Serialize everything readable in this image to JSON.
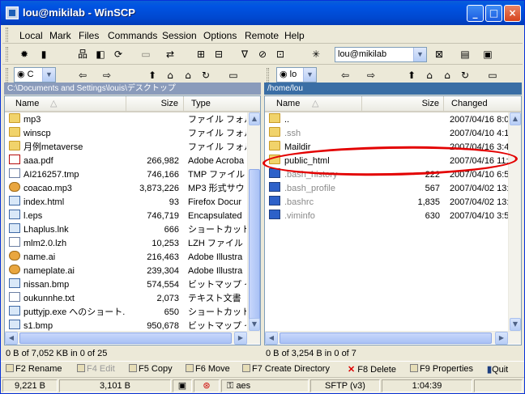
{
  "app": {
    "title": "lou@mikilab - WinSCP"
  },
  "menu": [
    "Local",
    "Mark",
    "Files",
    "Commands",
    "Session",
    "Options",
    "Remote",
    "Help"
  ],
  "toolbar": {
    "session": "lou@mikilab",
    "drive_left": "C",
    "drive_right": "lo"
  },
  "left": {
    "path": "C:\\Documents and Settings\\louis\\デスクトップ",
    "headers": {
      "name": "Name",
      "size": "Size",
      "type": "Type"
    },
    "rows": [
      {
        "name": "mp3",
        "size": "",
        "type": "ファイル フォルダ",
        "icon": "folder"
      },
      {
        "name": "winscp",
        "size": "",
        "type": "ファイル フォルダ",
        "icon": "folder"
      },
      {
        "name": "月例metaverse",
        "size": "",
        "type": "ファイル フォルダ",
        "icon": "folder"
      },
      {
        "name": "aaa.pdf",
        "size": "266,982",
        "type": "Adobe Acroba",
        "icon": "pdf"
      },
      {
        "name": "AI216257.tmp",
        "size": "746,166",
        "type": "TMP ファイル",
        "icon": "file"
      },
      {
        "name": "coacao.mp3",
        "size": "3,873,226",
        "type": "MP3 形式サウ",
        "icon": "mus"
      },
      {
        "name": "index.html",
        "size": "93",
        "type": "Firefox Docur",
        "icon": "img"
      },
      {
        "name": "l.eps",
        "size": "746,719",
        "type": "Encapsulated",
        "icon": "img"
      },
      {
        "name": "Lhaplus.lnk",
        "size": "666",
        "type": "ショートカット",
        "icon": "img"
      },
      {
        "name": "mlm2.0.lzh",
        "size": "10,253",
        "type": "LZH ファイル",
        "icon": "file"
      },
      {
        "name": "name.ai",
        "size": "216,463",
        "type": "Adobe Illustra",
        "icon": "mus"
      },
      {
        "name": "nameplate.ai",
        "size": "239,304",
        "type": "Adobe Illustra",
        "icon": "mus"
      },
      {
        "name": "nissan.bmp",
        "size": "574,554",
        "type": "ビットマップ イメ",
        "icon": "img"
      },
      {
        "name": "oukunnhe.txt",
        "size": "2,073",
        "type": "テキスト文書",
        "icon": "file"
      },
      {
        "name": "puttyjp.exe へのショート...",
        "size": "650",
        "type": "ショートカット",
        "icon": "img"
      },
      {
        "name": "s1.bmp",
        "size": "950,678",
        "type": "ビットマップ イメ",
        "icon": "img"
      }
    ],
    "status": "0 B of 7,052 KB in 0 of 25"
  },
  "right": {
    "path": "/home/lou",
    "headers": {
      "name": "Name",
      "size": "Size",
      "changed": "Changed"
    },
    "rows": [
      {
        "name": "..",
        "size": "",
        "changed": "2007/04/16 8:0...",
        "icon": "parent",
        "hidden": false
      },
      {
        "name": ".ssh",
        "size": "",
        "changed": "2007/04/10 4:1...",
        "icon": "folder",
        "hidden": true
      },
      {
        "name": "Maildir",
        "size": "",
        "changed": "2007/04/16 3:4...",
        "icon": "folder",
        "hidden": false
      },
      {
        "name": "public_html",
        "size": "",
        "changed": "2007/04/16 11:...",
        "icon": "folder",
        "hidden": false
      },
      {
        "name": ".bash_history",
        "size": "222",
        "changed": "2007/04/10 6:5...",
        "icon": "blue",
        "hidden": true
      },
      {
        "name": ".bash_profile",
        "size": "567",
        "changed": "2007/04/02 13:...",
        "icon": "blue",
        "hidden": true
      },
      {
        "name": ".bashrc",
        "size": "1,835",
        "changed": "2007/04/02 13:...",
        "icon": "blue",
        "hidden": true
      },
      {
        "name": ".viminfo",
        "size": "630",
        "changed": "2007/04/10 3:5...",
        "icon": "blue",
        "hidden": true
      }
    ],
    "status": "0 B of 3,254 B in 0 of 7"
  },
  "fkeys": [
    {
      "label": "F2 Rename",
      "enabled": true
    },
    {
      "label": "F4 Edit",
      "enabled": false
    },
    {
      "label": "F5 Copy",
      "enabled": true
    },
    {
      "label": "F6 Move",
      "enabled": true
    },
    {
      "label": "F7 Create Directory",
      "enabled": true
    },
    {
      "label": "F8 Delete",
      "enabled": true
    },
    {
      "label": "F9 Properties",
      "enabled": true
    },
    {
      "label": "Quit",
      "enabled": true
    }
  ],
  "statusbar": {
    "sent": "9,221 B",
    "received": "3,101 B",
    "cipher": "aes",
    "protocol": "SFTP (v3)",
    "time": "1:04:39"
  },
  "colors": {
    "titlebar": "#0054e3",
    "path_active": "#3a6ea5",
    "path_inactive": "#8a9bbb",
    "highlight": "#e30000"
  }
}
